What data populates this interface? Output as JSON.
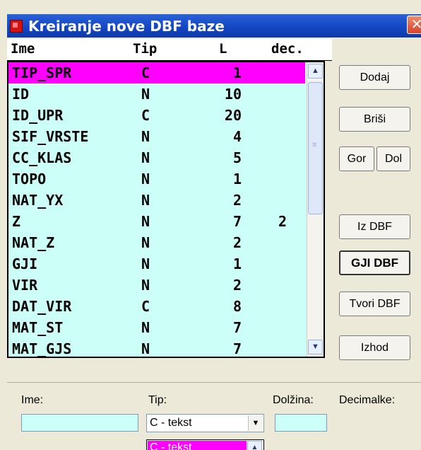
{
  "window": {
    "title": "Kreiranje nove DBF baze",
    "close_glyph": "✕"
  },
  "columns": {
    "ime": "Ime",
    "tip": "Tip",
    "l": "L",
    "dec": "dec."
  },
  "rows": [
    {
      "ime": "TIP_SPR",
      "tip": "C",
      "l": "1",
      "dec": "",
      "selected": true
    },
    {
      "ime": "ID",
      "tip": "N",
      "l": "10",
      "dec": ""
    },
    {
      "ime": "ID_UPR",
      "tip": "C",
      "l": "20",
      "dec": ""
    },
    {
      "ime": "SIF_VRSTE",
      "tip": "N",
      "l": "4",
      "dec": ""
    },
    {
      "ime": "CC_KLAS",
      "tip": "N",
      "l": "5",
      "dec": ""
    },
    {
      "ime": "TOPO",
      "tip": "N",
      "l": "1",
      "dec": ""
    },
    {
      "ime": "NAT_YX",
      "tip": "N",
      "l": "2",
      "dec": ""
    },
    {
      "ime": "Z",
      "tip": "N",
      "l": "7",
      "dec": "2"
    },
    {
      "ime": "NAT_Z",
      "tip": "N",
      "l": "2",
      "dec": ""
    },
    {
      "ime": "GJI",
      "tip": "N",
      "l": "1",
      "dec": ""
    },
    {
      "ime": "VIR",
      "tip": "N",
      "l": "2",
      "dec": ""
    },
    {
      "ime": "DAT_VIR",
      "tip": "C",
      "l": "8",
      "dec": ""
    },
    {
      "ime": "MAT_ST",
      "tip": "N",
      "l": "7",
      "dec": ""
    },
    {
      "ime": "MAT_GJS",
      "tip": "N",
      "l": "7",
      "dec": ""
    }
  ],
  "buttons": {
    "dodaj": "Dodaj",
    "brisi": "Briši",
    "gor": "Gor",
    "dol": "Dol",
    "izdbf": "Iz DBF",
    "gjidbf": "GJI DBF",
    "tvoridbf": "Tvori DBF",
    "izhod": "Izhod"
  },
  "form": {
    "ime_label": "Ime:",
    "tip_label": "Tip:",
    "dolzina_label": "Dolžina:",
    "decimalke_label": "Decimalke:",
    "tip_value": "C - tekst",
    "dropdown_option": "C - tekst"
  },
  "colors": {
    "selection": "#ff00ff",
    "list_bg": "#ccfff8",
    "titlebar": "#1f56cf"
  }
}
